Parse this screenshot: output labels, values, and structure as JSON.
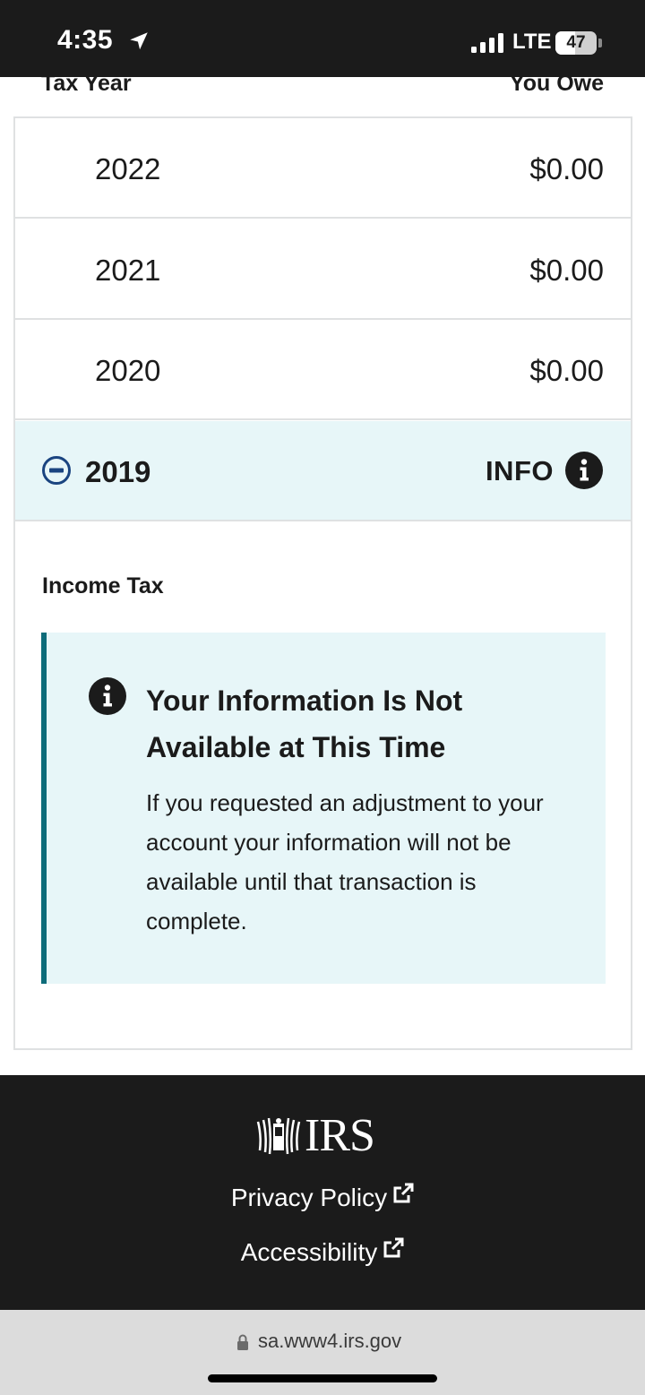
{
  "status_bar": {
    "time": "4:35",
    "carrier": "LTE",
    "battery": "47",
    "battery_level": 0.47
  },
  "table": {
    "header_left": "Tax Year",
    "header_right": "You Owe",
    "rows": [
      {
        "year": "2022",
        "amount": "$0.00"
      },
      {
        "year": "2021",
        "amount": "$0.00"
      },
      {
        "year": "2020",
        "amount": "$0.00"
      }
    ],
    "expanded_row": {
      "year": "2019",
      "status": "INFO"
    }
  },
  "detail": {
    "section_label": "Income Tax",
    "alert_title": "Your Information Is Not Available at This Time",
    "alert_body": "If you requested an adjustment to your account your information will not be available until that transaction is complete."
  },
  "footer": {
    "logo_text": "IRS",
    "links": [
      "Privacy Policy",
      "Accessibility"
    ]
  },
  "browser": {
    "url": "sa.www4.irs.gov"
  },
  "colors": {
    "accent": "#0d6c7a",
    "highlight_bg": "#e7f6f8",
    "dark": "#1b1b1b"
  }
}
